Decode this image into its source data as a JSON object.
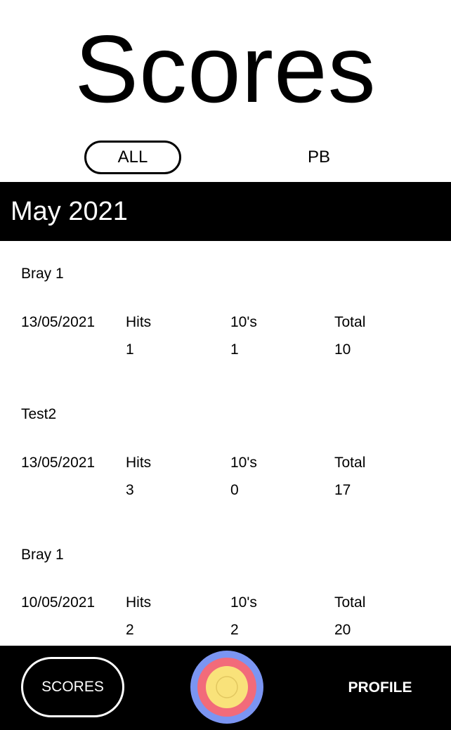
{
  "header": {
    "title": "Scores"
  },
  "tabs": [
    {
      "label": "ALL",
      "selected": true
    },
    {
      "label": "PB",
      "selected": false
    }
  ],
  "month": {
    "label": "May 2021"
  },
  "columns": {
    "hits": "Hits",
    "tens": "10's",
    "total": "Total"
  },
  "entries": [
    {
      "name": "Bray 1",
      "date": "13/05/2021",
      "hits": "1",
      "tens": "1",
      "total": "10"
    },
    {
      "name": "Test2",
      "date": "13/05/2021",
      "hits": "3",
      "tens": "0",
      "total": "17"
    },
    {
      "name": "Bray 1",
      "date": "10/05/2021",
      "hits": "2",
      "tens": "2",
      "total": "20"
    }
  ],
  "nav": {
    "scores_label": "SCORES",
    "profile_label": "PROFILE",
    "target_icon": "archery-target-icon",
    "target_colors": {
      "outer": "#7b95f2",
      "middle": "#f26b7a",
      "inner": "#f9e27a"
    }
  }
}
